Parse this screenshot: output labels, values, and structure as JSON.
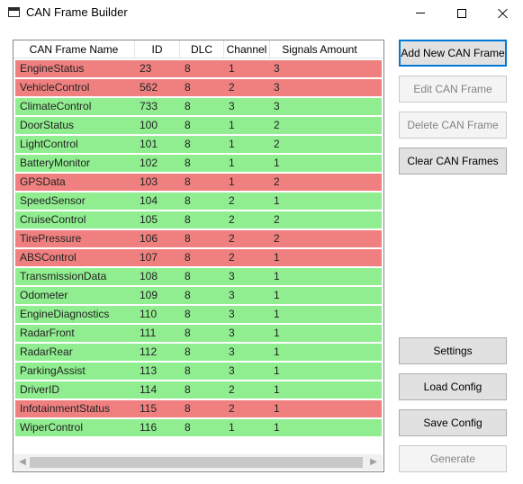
{
  "window": {
    "title": "CAN Frame Builder"
  },
  "grid": {
    "columns": [
      "CAN Frame Name",
      "ID",
      "DLC",
      "Channel",
      "Signals Amount"
    ],
    "rows": [
      {
        "name": "EngineStatus",
        "id": "23",
        "dlc": "8",
        "channel": "1",
        "signals": "3",
        "status": "red"
      },
      {
        "name": "VehicleControl",
        "id": "562",
        "dlc": "8",
        "channel": "2",
        "signals": "3",
        "status": "red"
      },
      {
        "name": "ClimateControl",
        "id": "733",
        "dlc": "8",
        "channel": "3",
        "signals": "3",
        "status": "green"
      },
      {
        "name": "DoorStatus",
        "id": "100",
        "dlc": "8",
        "channel": "1",
        "signals": "2",
        "status": "green"
      },
      {
        "name": "LightControl",
        "id": "101",
        "dlc": "8",
        "channel": "1",
        "signals": "2",
        "status": "green"
      },
      {
        "name": "BatteryMonitor",
        "id": "102",
        "dlc": "8",
        "channel": "1",
        "signals": "1",
        "status": "green"
      },
      {
        "name": "GPSData",
        "id": "103",
        "dlc": "8",
        "channel": "1",
        "signals": "2",
        "status": "red"
      },
      {
        "name": "SpeedSensor",
        "id": "104",
        "dlc": "8",
        "channel": "2",
        "signals": "1",
        "status": "green"
      },
      {
        "name": "CruiseControl",
        "id": "105",
        "dlc": "8",
        "channel": "2",
        "signals": "2",
        "status": "green"
      },
      {
        "name": "TirePressure",
        "id": "106",
        "dlc": "8",
        "channel": "2",
        "signals": "2",
        "status": "red"
      },
      {
        "name": "ABSControl",
        "id": "107",
        "dlc": "8",
        "channel": "2",
        "signals": "1",
        "status": "red"
      },
      {
        "name": "TransmissionData",
        "id": "108",
        "dlc": "8",
        "channel": "3",
        "signals": "1",
        "status": "green"
      },
      {
        "name": "Odometer",
        "id": "109",
        "dlc": "8",
        "channel": "3",
        "signals": "1",
        "status": "green"
      },
      {
        "name": "EngineDiagnostics",
        "id": "110",
        "dlc": "8",
        "channel": "3",
        "signals": "1",
        "status": "green"
      },
      {
        "name": "RadarFront",
        "id": "111",
        "dlc": "8",
        "channel": "3",
        "signals": "1",
        "status": "green"
      },
      {
        "name": "RadarRear",
        "id": "112",
        "dlc": "8",
        "channel": "3",
        "signals": "1",
        "status": "green"
      },
      {
        "name": "ParkingAssist",
        "id": "113",
        "dlc": "8",
        "channel": "3",
        "signals": "1",
        "status": "green"
      },
      {
        "name": "DriverID",
        "id": "114",
        "dlc": "8",
        "channel": "2",
        "signals": "1",
        "status": "green"
      },
      {
        "name": "InfotainmentStatus",
        "id": "115",
        "dlc": "8",
        "channel": "2",
        "signals": "1",
        "status": "red"
      },
      {
        "name": "WiperControl",
        "id": "116",
        "dlc": "8",
        "channel": "1",
        "signals": "1",
        "status": "green"
      }
    ]
  },
  "buttons": {
    "add": "Add New CAN Frame",
    "edit": "Edit CAN Frame",
    "delete": "Delete CAN Frame",
    "clear": "Clear CAN Frames",
    "settings": "Settings",
    "load": "Load Config",
    "save": "Save Config",
    "generate": "Generate"
  },
  "colors": {
    "row_red": "#f08080",
    "row_green": "#90ee90",
    "accent": "#0078d7"
  }
}
